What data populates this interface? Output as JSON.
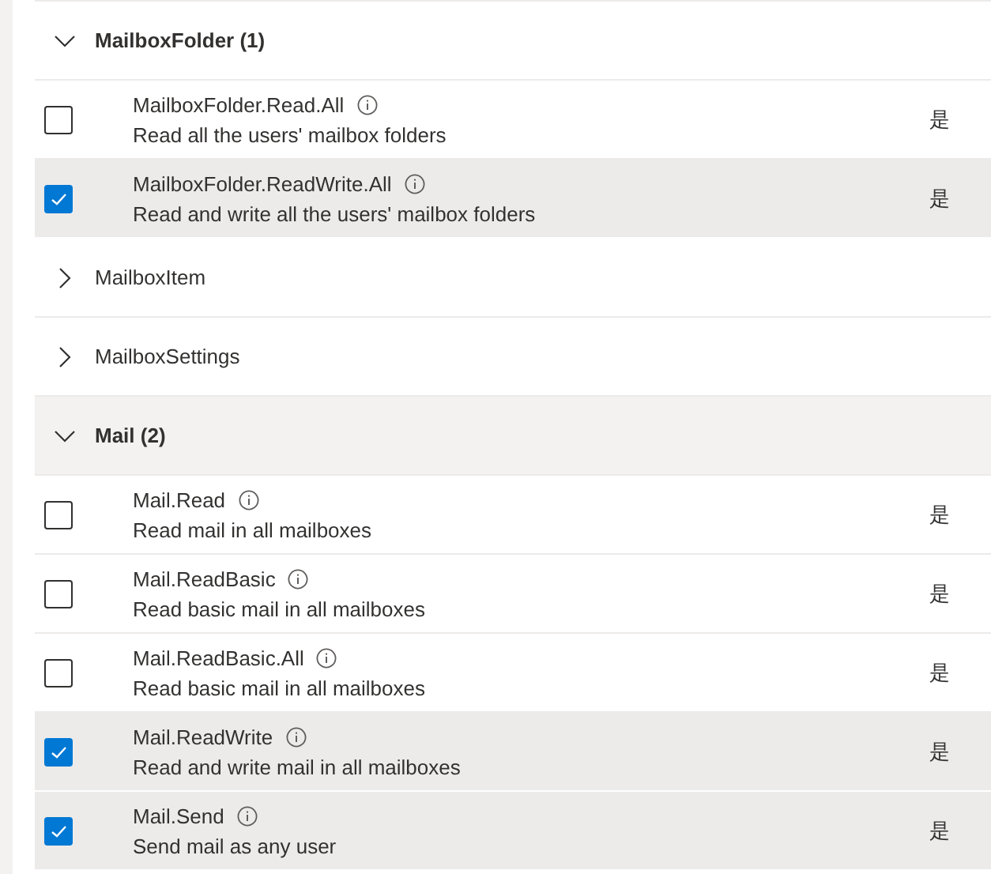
{
  "groups": [
    {
      "label": "MailboxFolder (1)",
      "expanded": true,
      "hovered": false,
      "permissions": [
        {
          "name": "MailboxFolder.Read.All",
          "description": "Read all the users' mailbox folders",
          "checked": false,
          "admin_consent": "是"
        },
        {
          "name": "MailboxFolder.ReadWrite.All",
          "description": "Read and write all the users' mailbox folders",
          "checked": true,
          "admin_consent": "是"
        }
      ]
    },
    {
      "label": "MailboxItem",
      "expanded": false,
      "hovered": false
    },
    {
      "label": "MailboxSettings",
      "expanded": false,
      "hovered": false
    },
    {
      "label": "Mail (2)",
      "expanded": true,
      "hovered": true,
      "permissions": [
        {
          "name": "Mail.Read",
          "description": "Read mail in all mailboxes",
          "checked": false,
          "admin_consent": "是"
        },
        {
          "name": "Mail.ReadBasic",
          "description": "Read basic mail in all mailboxes",
          "checked": false,
          "admin_consent": "是"
        },
        {
          "name": "Mail.ReadBasic.All",
          "description": "Read basic mail in all mailboxes",
          "checked": false,
          "admin_consent": "是"
        },
        {
          "name": "Mail.ReadWrite",
          "description": "Read and write mail in all mailboxes",
          "checked": true,
          "admin_consent": "是"
        },
        {
          "name": "Mail.Send",
          "description": "Send mail as any user",
          "checked": true,
          "admin_consent": "是"
        }
      ]
    }
  ]
}
